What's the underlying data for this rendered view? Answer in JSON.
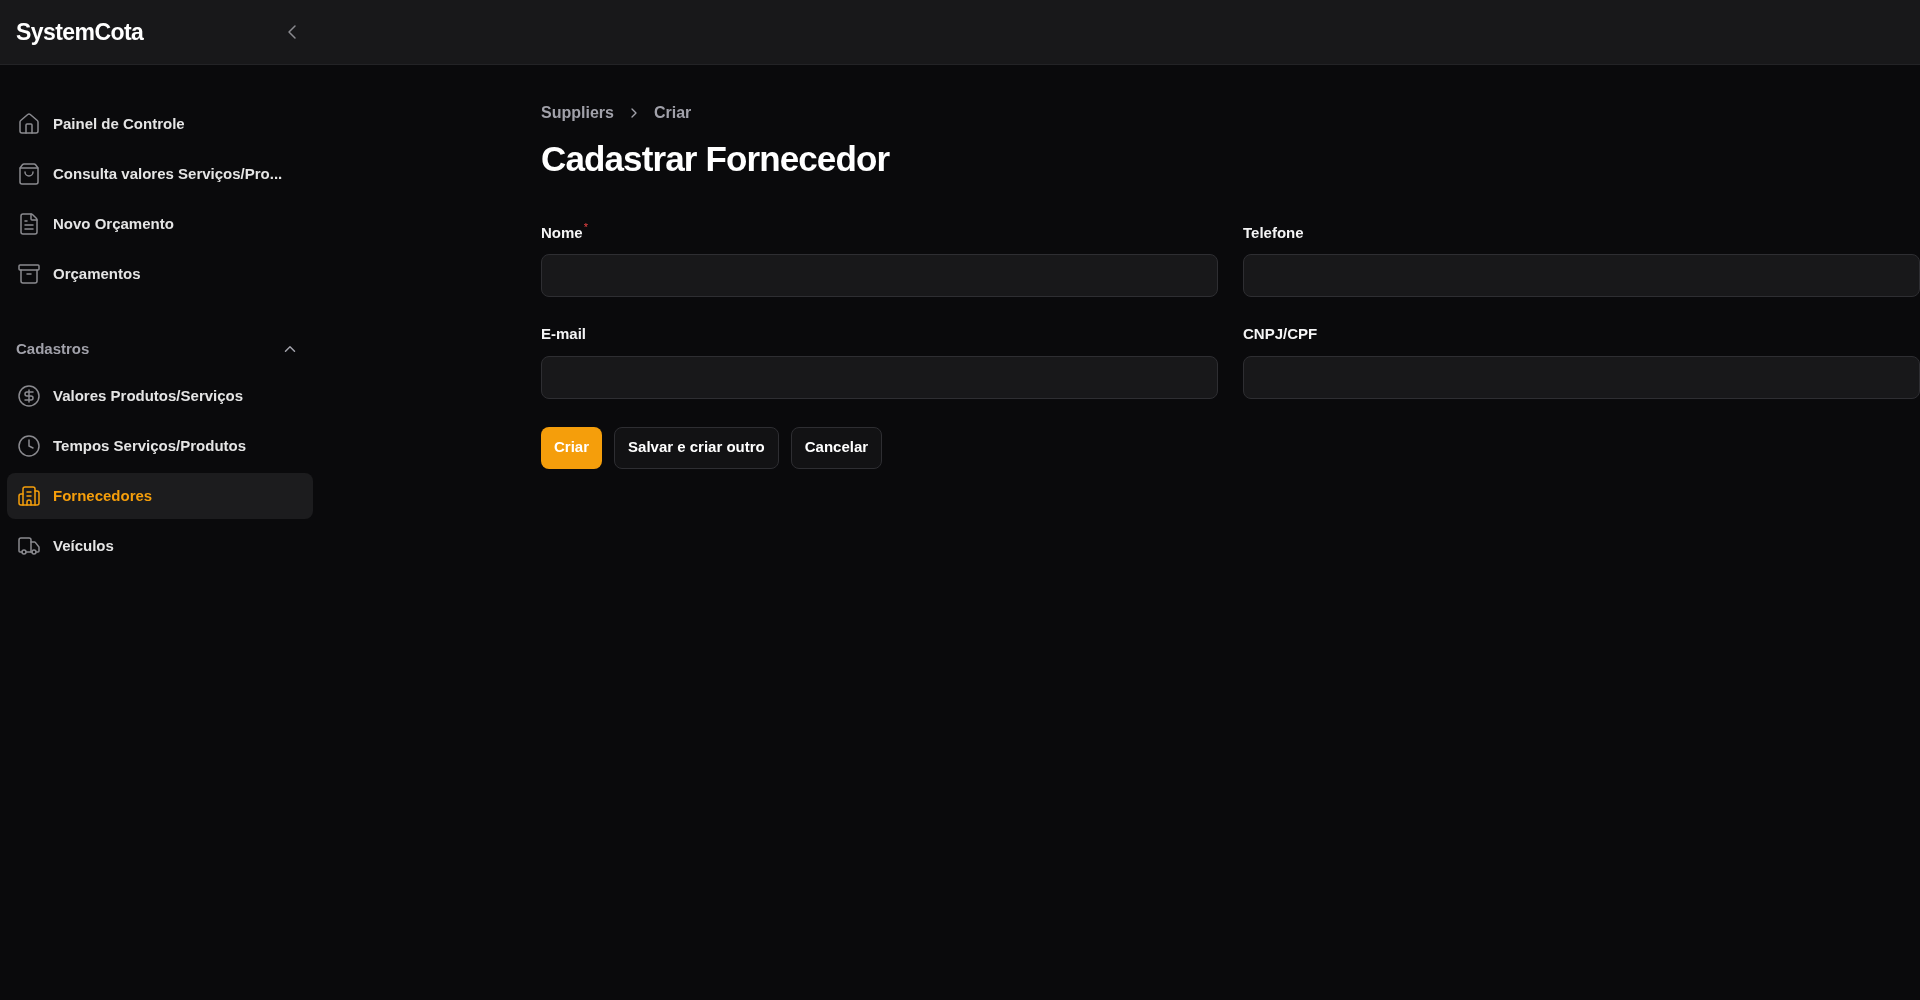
{
  "brand": "SystemCota",
  "nav": {
    "items": [
      {
        "label": "Painel de Controle",
        "kind": "home",
        "selected": false
      },
      {
        "label": "Consulta valores Serviços/Pro...",
        "kind": "bag",
        "selected": false
      },
      {
        "label": "Novo Orçamento",
        "kind": "file",
        "selected": false
      },
      {
        "label": "Orçamentos",
        "kind": "archive",
        "selected": false
      }
    ],
    "groups": [
      {
        "label": "Cadastros",
        "expanded": true,
        "items": [
          {
            "label": "Valores Produtos/Serviços",
            "kind": "dollar",
            "selected": false
          },
          {
            "label": "Tempos Serviços/Produtos",
            "kind": "clock",
            "selected": false
          },
          {
            "label": "Fornecedores",
            "kind": "building",
            "selected": true
          },
          {
            "label": "Veículos",
            "kind": "truck",
            "selected": false
          }
        ]
      }
    ]
  },
  "breadcrumb": [
    "Suppliers",
    "Criar"
  ],
  "title": "Cadastrar Fornecedor",
  "fields": [
    {
      "label": "Nome",
      "required_mark": "*"
    },
    {
      "label": "Telefone"
    },
    {
      "label": "E-mail"
    },
    {
      "label": "CNPJ/CPF"
    }
  ],
  "buttons": [
    {
      "label": "Criar",
      "kind": "primary"
    },
    {
      "label": "Salvar e criar outro",
      "kind": "secondary"
    },
    {
      "label": "Cancelar",
      "kind": "secondary"
    }
  ]
}
